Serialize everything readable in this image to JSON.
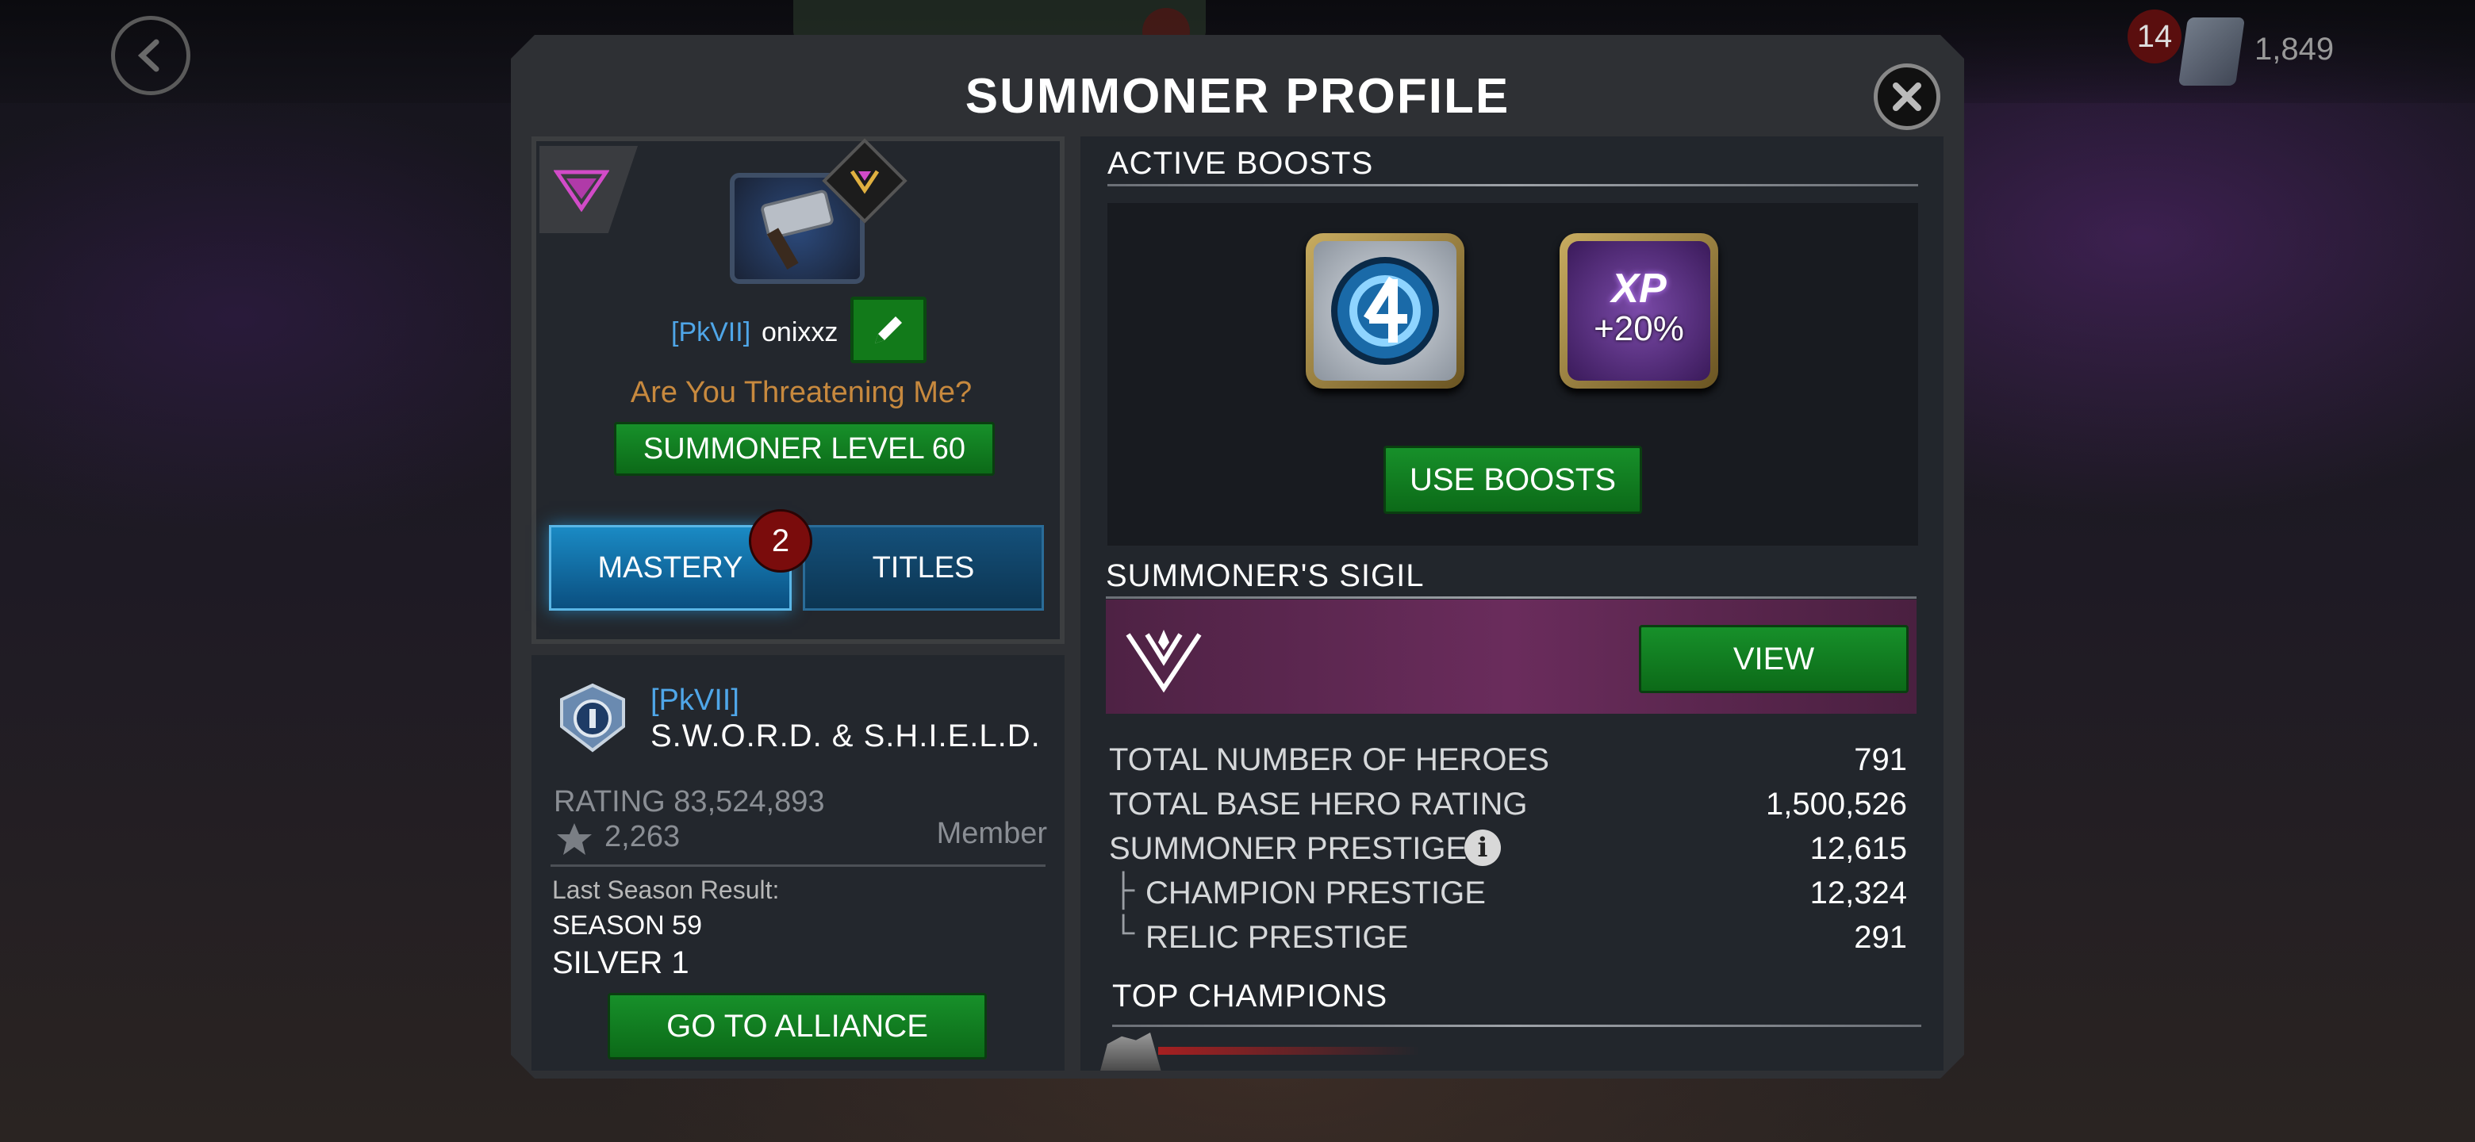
{
  "top_bar": {
    "units_badge": "14",
    "units_count": "1,849"
  },
  "modal": {
    "title": "SUMMONER PROFILE"
  },
  "profile": {
    "alliance_tag": "[PkVII]",
    "player_name": "onixxz",
    "player_title": "Are You Threatening Me?",
    "level_label": "SUMMONER LEVEL 60",
    "tabs": [
      {
        "label": "MASTERY",
        "badge": "2"
      },
      {
        "label": "TITLES"
      }
    ]
  },
  "alliance": {
    "tag": "[PkVII]",
    "name": "S.W.O.R.D. & S.H.I.E.L.D.",
    "rating": "RATING 83,524,893",
    "war_rating": "2,263",
    "role": "Member",
    "last_season_label": "Last Season Result:",
    "season": "SEASON 59",
    "season_rank": "SILVER 1",
    "goto_label": "GO TO ALLIANCE"
  },
  "boosts": {
    "header": "ACTIVE BOOSTS",
    "xp_letters": "XP",
    "xp_pct": "+20%",
    "use_label": "USE BOOSTS"
  },
  "sigil": {
    "header": "SUMMONER'S SIGIL",
    "view_label": "VIEW"
  },
  "stats": [
    {
      "label": "TOTAL NUMBER OF HEROES",
      "value": "791"
    },
    {
      "label": "TOTAL BASE HERO RATING",
      "value": "1,500,526"
    },
    {
      "label": "SUMMONER PRESTIGE",
      "value": "12,615"
    },
    {
      "label": "CHAMPION PRESTIGE",
      "value": "12,324"
    },
    {
      "label": "RELIC PRESTIGE",
      "value": "291"
    }
  ],
  "top_champions": {
    "header": "TOP CHAMPIONS"
  },
  "colors": {
    "green_button": "#127a1a",
    "accent_blue": "#4fa6e8",
    "title_gold": "#c7893e",
    "badge_red": "#7a0c0c"
  }
}
